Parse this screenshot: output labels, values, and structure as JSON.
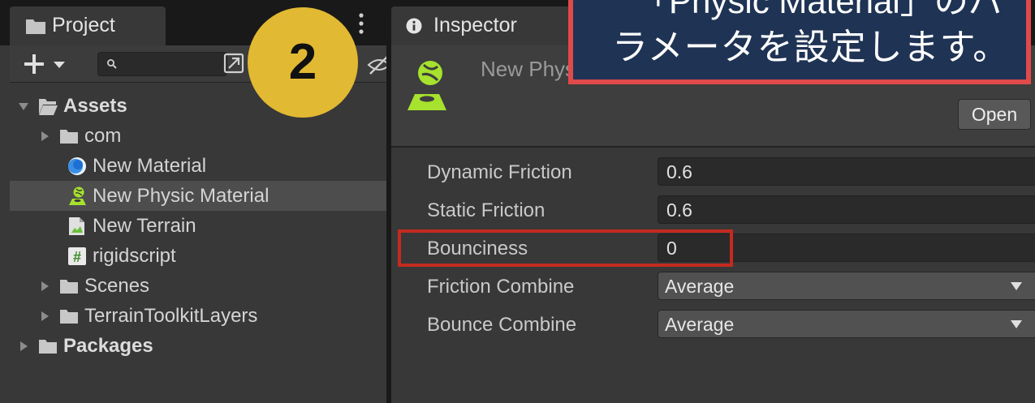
{
  "project": {
    "tab_label": "Project",
    "search": {
      "value": "",
      "placeholder": ""
    },
    "tree": [
      {
        "label": "Assets"
      },
      {
        "label": "com"
      },
      {
        "label": "New Material"
      },
      {
        "label": "New Physic Material"
      },
      {
        "label": "New Terrain"
      },
      {
        "label": "rigidscript"
      },
      {
        "label": "Scenes"
      },
      {
        "label": "TerrainToolkitLayers"
      },
      {
        "label": "Packages"
      }
    ]
  },
  "inspector": {
    "tab_label": "Inspector",
    "asset_title": "New Physic Material (Physic Material)",
    "open_label": "Open",
    "properties": [
      {
        "label": "Dynamic Friction",
        "value": "0.6"
      },
      {
        "label": "Static Friction",
        "value": "0.6"
      },
      {
        "label": "Bounciness",
        "value": "0"
      },
      {
        "label": "Friction Combine",
        "value": "Average"
      },
      {
        "label": "Bounce Combine",
        "value": "Average"
      }
    ]
  },
  "overlay": {
    "step_number": "2",
    "callout_line1": "「Physic Material」のパ",
    "callout_line2": "ラメータを設定します。"
  },
  "colors": {
    "panel_bg": "#383838",
    "selected_row": "#4d4d4d",
    "physic_icon_green": "#a6e22e",
    "step_badge": "#e2b932",
    "callout_bg": "#1f3354",
    "highlight_red": "#c42a20"
  },
  "icons": {
    "project_tab": "folder-icon",
    "inspector_tab": "info-icon",
    "asset": "physic-material-icon"
  }
}
